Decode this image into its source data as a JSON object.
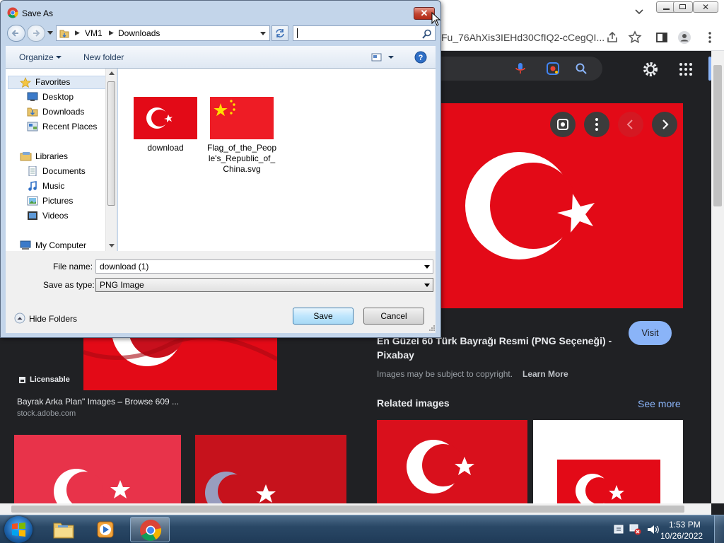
{
  "browser": {
    "url_fragment": "Fu_76AhXis3IEHd30CfIQ2-cCegQI...",
    "colors": {
      "page_bg": "#202124",
      "accent": "#8ab4f8",
      "visit_bg": "#8ab4f8"
    }
  },
  "results_left": [
    {
      "badge": "Licensable",
      "title": "Bayrak Arka Plan\" Images – Browse 609 ...",
      "source": "stock.adobe.com"
    }
  ],
  "preview": {
    "title_line1": "En Güzel 60 Türk Bayrağı Resmi (PNG Seçeneği) -",
    "title_line2": "Pixabay",
    "copyright": "Images may be subject to copyright.",
    "learn_more": "Learn More",
    "visit_label": "Visit",
    "related_heading": "Related images",
    "see_more": "See more"
  },
  "dialog": {
    "title": "Save As",
    "breadcrumb": [
      "VM1",
      "Downloads"
    ],
    "toolbar": {
      "organize": "Organize",
      "new_folder": "New folder"
    },
    "nav": {
      "favorites_header": "Favorites",
      "favorites": [
        "Desktop",
        "Downloads",
        "Recent Places"
      ],
      "libraries_header": "Libraries",
      "libraries": [
        "Documents",
        "Music",
        "Pictures",
        "Videos"
      ],
      "computer": "My Computer"
    },
    "files": [
      {
        "name": "download",
        "flag": "turkey"
      },
      {
        "name_lines": [
          "Flag_of_the_Peop",
          "le's_Republic_of_",
          "China.svg"
        ],
        "flag": "china"
      }
    ],
    "file_name_label": "File name:",
    "file_name_value": "download (1)",
    "save_type_label": "Save as type:",
    "save_type_value": "PNG Image",
    "hide_folders": "Hide Folders",
    "save_label": "Save",
    "cancel_label": "Cancel"
  },
  "taskbar": {
    "time": "1:53 PM",
    "date": "10/26/2022"
  }
}
